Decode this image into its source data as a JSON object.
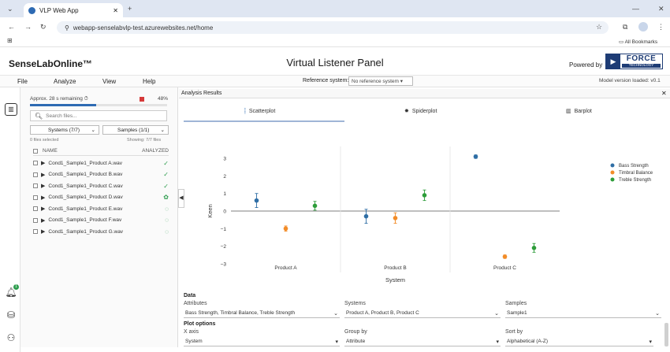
{
  "browser": {
    "tab_title": "VLP Web App",
    "url": "webapp-senselabvlp-test.azurewebsites.net/home",
    "all_bookmarks": "All Bookmarks"
  },
  "app": {
    "brand": "SenseLabOnline™",
    "title": "Virtual Listener Panel",
    "powered_by": "Powered by",
    "logo_top": "FORCE",
    "logo_bottom": "TECHNOLOGY"
  },
  "menu": {
    "items": [
      "File",
      "Analyze",
      "View",
      "Help"
    ],
    "reference_label": "Reference system:",
    "reference_value": "No reference system",
    "model_version": "Model version loaded: v0.1"
  },
  "list_panel": {
    "progress_label": "Approx. 28 s remaining ⏱",
    "progress_percent": "48%",
    "progress_fraction": 0.48,
    "search_placeholder": "Search files...",
    "systems_filter": "Systems (7/7)",
    "samples_filter": "Samples (1/1)",
    "selected": "0 files selected",
    "showing": "Showing: 7/7 files",
    "col_name": "NAME",
    "col_analyzed": "ANALYZED",
    "files": [
      {
        "name": "Cond1_Sample1_Product A.wav",
        "status": "✓",
        "color": "#2e9d4e"
      },
      {
        "name": "Cond1_Sample1_Product B.wav",
        "status": "✓",
        "color": "#2e9d4e"
      },
      {
        "name": "Cond1_Sample1_Product C.wav",
        "status": "✓",
        "color": "#2e9d4e"
      },
      {
        "name": "Cond1_Sample1_Product D.wav",
        "status": "✿",
        "color": "#2e9d4e"
      },
      {
        "name": "Cond1_Sample1_Product E.wav",
        "status": "◌",
        "color": "#2e9d4e"
      },
      {
        "name": "Cond1_Sample1_Product F.wav",
        "status": "◌",
        "color": "#2e9d4e"
      },
      {
        "name": "Cond1_Sample1_Product G.wav",
        "status": "◌",
        "color": "#2e9d4e"
      }
    ]
  },
  "analysis": {
    "header": "Analysis Results",
    "tabs": [
      "Scatterplot",
      "Spiderplot",
      "Barplot"
    ]
  },
  "chart_data": {
    "type": "scatter",
    "categories": [
      "Product A",
      "Product B",
      "Product C"
    ],
    "xlabel": "System",
    "ylabel": "Keen",
    "ylim": [
      -3,
      3
    ],
    "yticks": [
      3,
      2,
      1,
      0,
      -1,
      -2,
      -3
    ],
    "legend_position": "top-right",
    "series": [
      {
        "name": "Bass Strength",
        "color": "#2f6ea5",
        "values": [
          0.6,
          -0.3,
          3.1
        ],
        "errors": [
          0.4,
          0.4,
          0.1
        ]
      },
      {
        "name": "Timbral Balance",
        "color": "#f28c28",
        "values": [
          -1.0,
          -0.4,
          -2.6
        ],
        "errors": [
          0.15,
          0.3,
          0.1
        ]
      },
      {
        "name": "Treble Strength",
        "color": "#2e9d3a",
        "values": [
          0.3,
          0.9,
          -2.1
        ],
        "errors": [
          0.25,
          0.3,
          0.25
        ]
      }
    ]
  },
  "form": {
    "data_heading": "Data",
    "attributes_label": "Attributes",
    "attributes_value": "Bass Strength, Timbral Balance, Treble Strength",
    "systems_label": "Systems",
    "systems_value": "Product A, Product B, Product C",
    "samples_label": "Samples",
    "samples_value": "Sample1",
    "plot_heading": "Plot options",
    "xaxis_label": "X axis",
    "xaxis_value": "System",
    "groupby_label": "Group by",
    "groupby_value": "Attribute",
    "sortby_label": "Sort by",
    "sortby_value": "Alphabetical (A-Z)"
  }
}
